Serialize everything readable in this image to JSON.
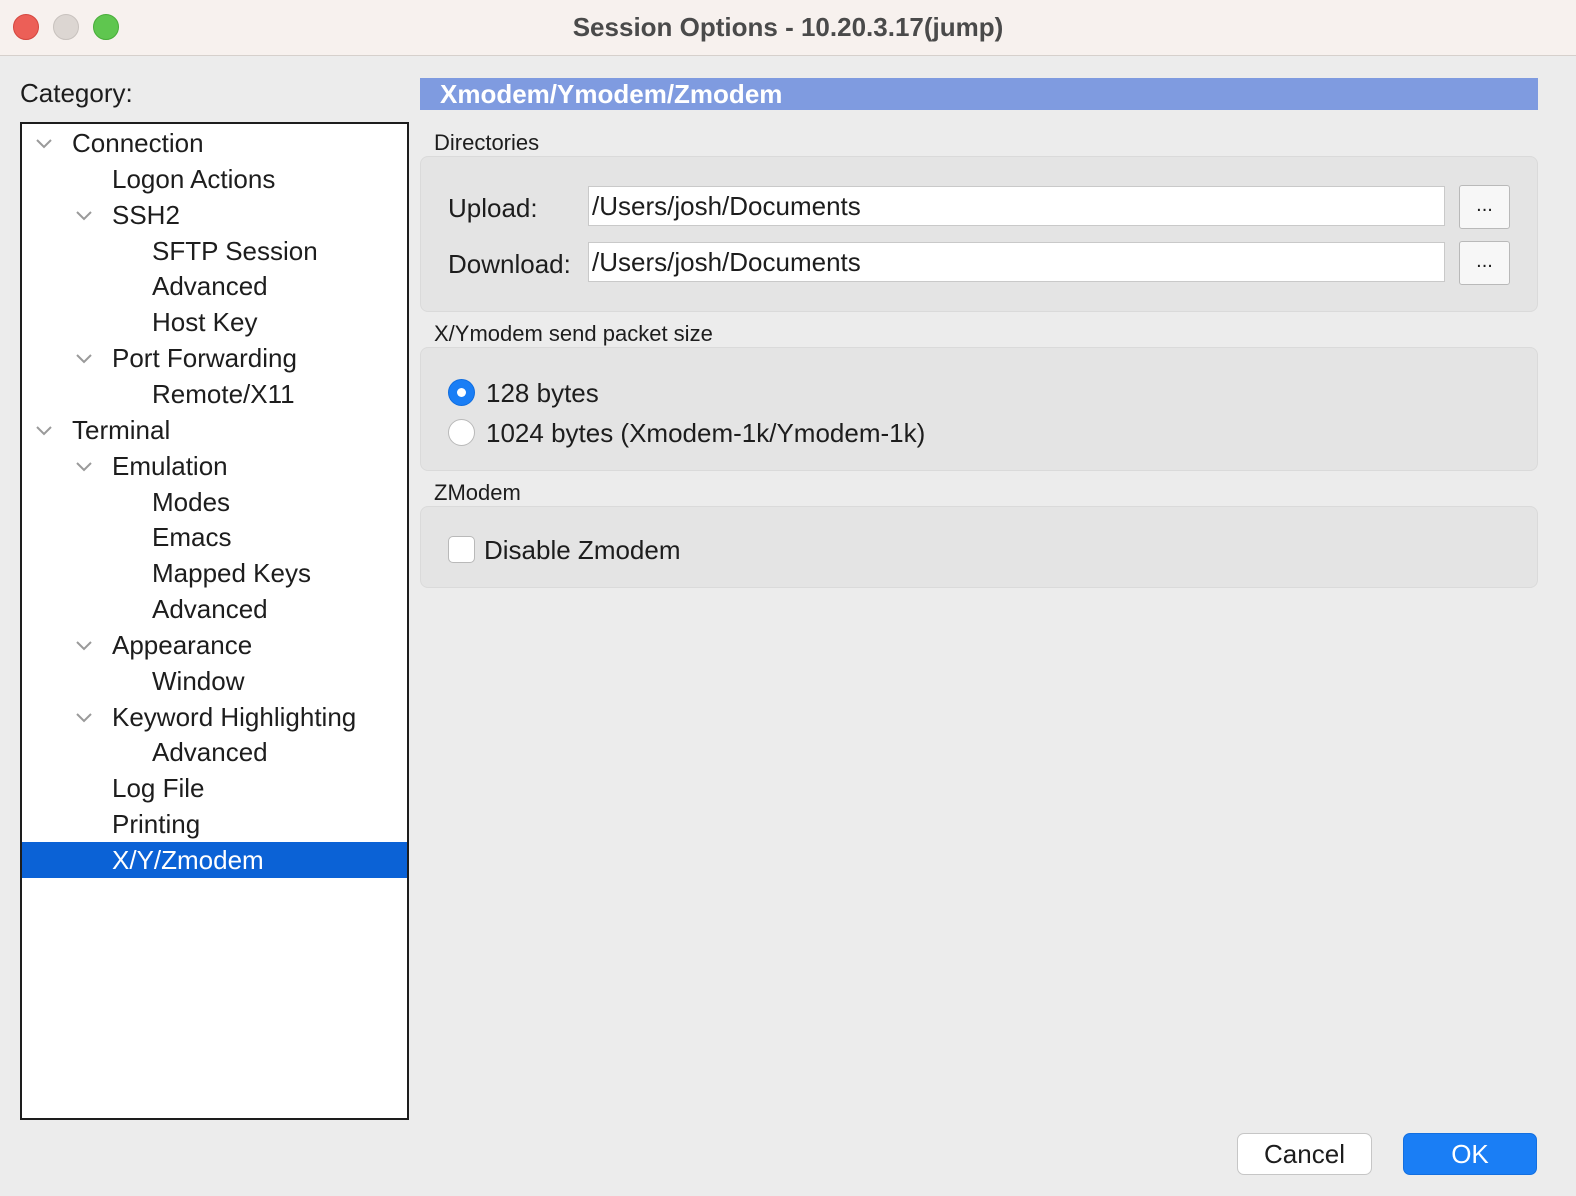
{
  "window": {
    "title": "Session Options - 10.20.3.17(jump)"
  },
  "sidebar": {
    "label": "Category:",
    "items": [
      {
        "label": "Connection",
        "level": 0,
        "expandable": true,
        "selected": false
      },
      {
        "label": "Logon Actions",
        "level": 1,
        "expandable": false,
        "selected": false
      },
      {
        "label": "SSH2",
        "level": 1,
        "expandable": true,
        "selected": false
      },
      {
        "label": "SFTP Session",
        "level": 2,
        "expandable": false,
        "selected": false
      },
      {
        "label": "Advanced",
        "level": 2,
        "expandable": false,
        "selected": false
      },
      {
        "label": "Host Key",
        "level": 2,
        "expandable": false,
        "selected": false
      },
      {
        "label": "Port Forwarding",
        "level": 1,
        "expandable": true,
        "selected": false
      },
      {
        "label": "Remote/X11",
        "level": 2,
        "expandable": false,
        "selected": false
      },
      {
        "label": "Terminal",
        "level": 0,
        "expandable": true,
        "selected": false
      },
      {
        "label": "Emulation",
        "level": 1,
        "expandable": true,
        "selected": false
      },
      {
        "label": "Modes",
        "level": 2,
        "expandable": false,
        "selected": false
      },
      {
        "label": "Emacs",
        "level": 2,
        "expandable": false,
        "selected": false
      },
      {
        "label": "Mapped Keys",
        "level": 2,
        "expandable": false,
        "selected": false
      },
      {
        "label": "Advanced",
        "level": 2,
        "expandable": false,
        "selected": false
      },
      {
        "label": "Appearance",
        "level": 1,
        "expandable": true,
        "selected": false
      },
      {
        "label": "Window",
        "level": 2,
        "expandable": false,
        "selected": false
      },
      {
        "label": "Keyword Highlighting",
        "level": 1,
        "expandable": true,
        "selected": false
      },
      {
        "label": "Advanced",
        "level": 2,
        "expandable": false,
        "selected": false
      },
      {
        "label": "Log File",
        "level": 1,
        "expandable": false,
        "selected": false
      },
      {
        "label": "Printing",
        "level": 1,
        "expandable": false,
        "selected": false
      },
      {
        "label": "X/Y/Zmodem",
        "level": 1,
        "expandable": false,
        "selected": true
      }
    ]
  },
  "panel": {
    "header": "Xmodem/Ymodem/Zmodem",
    "directories": {
      "label": "Directories",
      "upload_label": "Upload:",
      "upload_value": "/Users/josh/Documents",
      "download_label": "Download:",
      "download_value": "/Users/josh/Documents",
      "browse_label": "..."
    },
    "packet_size": {
      "label": "X/Ymodem send packet size",
      "options": [
        {
          "label": "128 bytes",
          "selected": true
        },
        {
          "label": "1024 bytes (Xmodem-1k/Ymodem-1k)",
          "selected": false
        }
      ]
    },
    "zmodem": {
      "label": "ZModem",
      "disable_label": "Disable Zmodem",
      "disable_checked": false
    }
  },
  "footer": {
    "cancel_label": "Cancel",
    "ok_label": "OK"
  },
  "colors": {
    "accent": "#1a7ef5",
    "selection": "#0b62d6",
    "header_bar": "#7f9be0"
  }
}
